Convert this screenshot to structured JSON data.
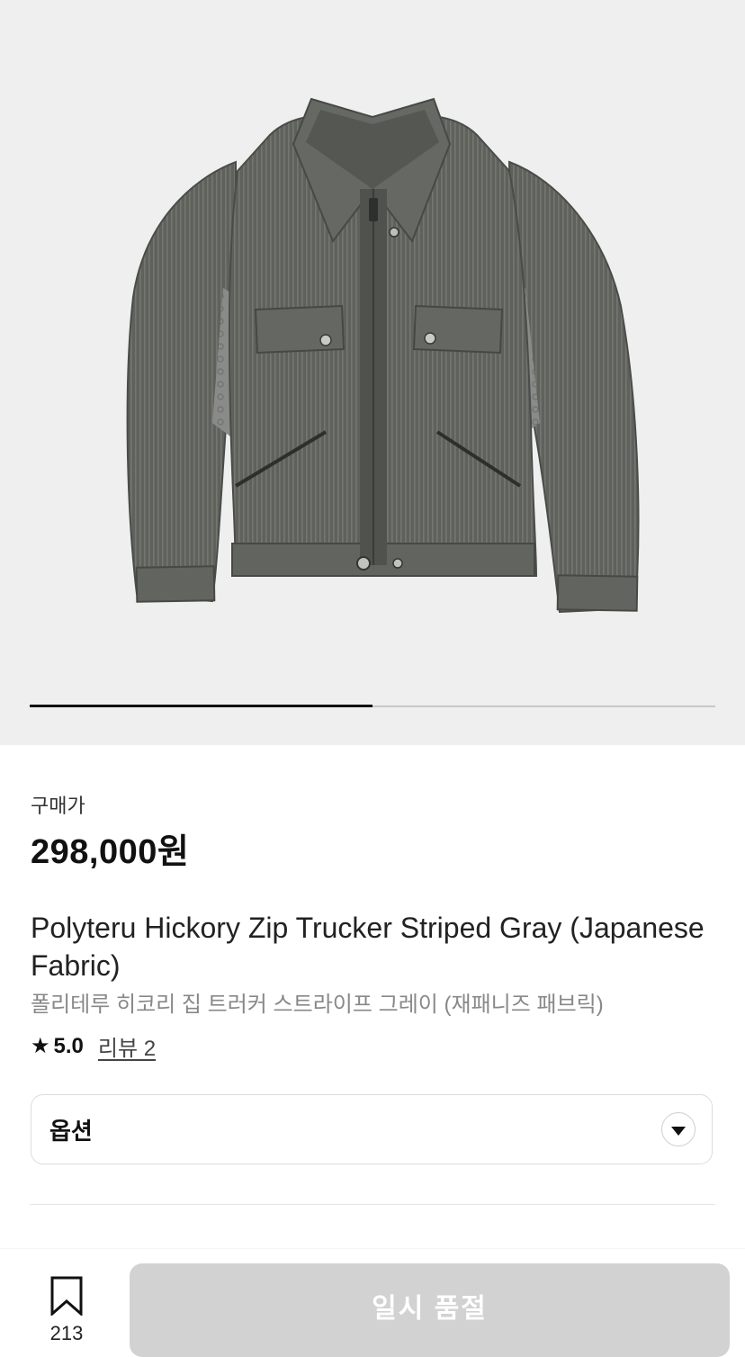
{
  "gallery": {
    "image_alt": "jacket-photo",
    "progress": 0.5
  },
  "product": {
    "price_label": "구매가",
    "price": "298,000원",
    "title_en": "Polyteru Hickory Zip Trucker Striped Gray (Japanese Fabric)",
    "title_ko": "폴리테루 히코리 집 트러커 스트라이프 그레이 (재패니즈 패브릭)",
    "rating": "5.0",
    "review_link": "리뷰 2"
  },
  "option": {
    "label": "옵션"
  },
  "bottom_bar": {
    "bookmark_count": "213",
    "cta_label": "일시 품절"
  },
  "colors": {
    "gallery_bg": "#efefef",
    "cta_disabled": "#d2d2d2",
    "jacket": "#5e605c"
  }
}
